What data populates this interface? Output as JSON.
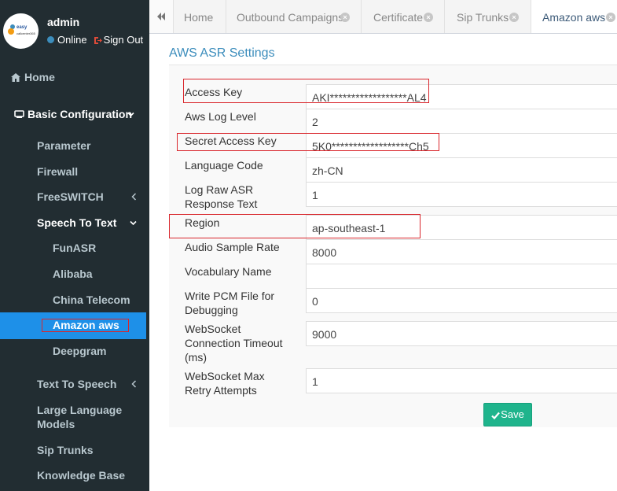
{
  "user": {
    "name": "admin",
    "status": "Online",
    "signout_label": "Sign Out",
    "logo_line1": "easy",
    "logo_line2": "callcenter365"
  },
  "sidebar": {
    "home": "Home",
    "basic_config": "Basic Configuration",
    "items": [
      "Parameter",
      "Firewall",
      "FreeSWITCH",
      "Speech To Text",
      "Text To Speech",
      "Large Language Models",
      "Sip Trunks",
      "Knowledge Base"
    ],
    "stt_items": [
      "FunASR",
      "Alibaba",
      "China Telecom",
      "Amazon aws",
      "Deepgram"
    ],
    "active_item": "Amazon aws",
    "large_language_line1": "Large Language",
    "large_language_line2": "Models"
  },
  "tabs": [
    {
      "label": "Home",
      "closable": false
    },
    {
      "label": "Outbound Campaigns",
      "closable": true
    },
    {
      "label": "Certificate",
      "closable": true
    },
    {
      "label": "Sip Trunks",
      "closable": true
    },
    {
      "label": "Amazon aws",
      "closable": true,
      "active": true
    }
  ],
  "page": {
    "title": "AWS ASR Settings"
  },
  "form": {
    "access_key": {
      "label": "Access Key",
      "value": "AKI******************AL4"
    },
    "aws_log_level": {
      "label": "Aws Log Level",
      "value": "2"
    },
    "secret_access_key": {
      "label": "Secret Access Key",
      "value": "5K0******************Ch5"
    },
    "language_code": {
      "label": "Language Code",
      "value": "zh-CN"
    },
    "log_raw": {
      "label_line1": "Log Raw ASR",
      "label_line2": "Response Text",
      "value": "1"
    },
    "region": {
      "label": "Region",
      "value": "ap-southeast-1"
    },
    "audio_sample_rate": {
      "label": "Audio Sample Rate",
      "value": "8000"
    },
    "vocabulary_name": {
      "label": "Vocabulary Name",
      "value": ""
    },
    "write_pcm": {
      "label_line1": "Write PCM File for",
      "label_line2": "Debugging",
      "value": "0"
    },
    "ws_timeout": {
      "label_line1": "WebSocket",
      "label_line2": "Connection Timeout",
      "label_line3": "(ms)",
      "value": "9000"
    },
    "ws_retry": {
      "label_line1": "WebSocket Max",
      "label_line2": "Retry Attempts",
      "value": "1"
    },
    "save_label": "Save"
  },
  "colors": {
    "sidebar_bg": "#222d32",
    "active_bg": "#1e90e8",
    "accent": "#3c8dbc",
    "save_btn": "#1fb48c",
    "highlight_box": "#d9262c"
  }
}
